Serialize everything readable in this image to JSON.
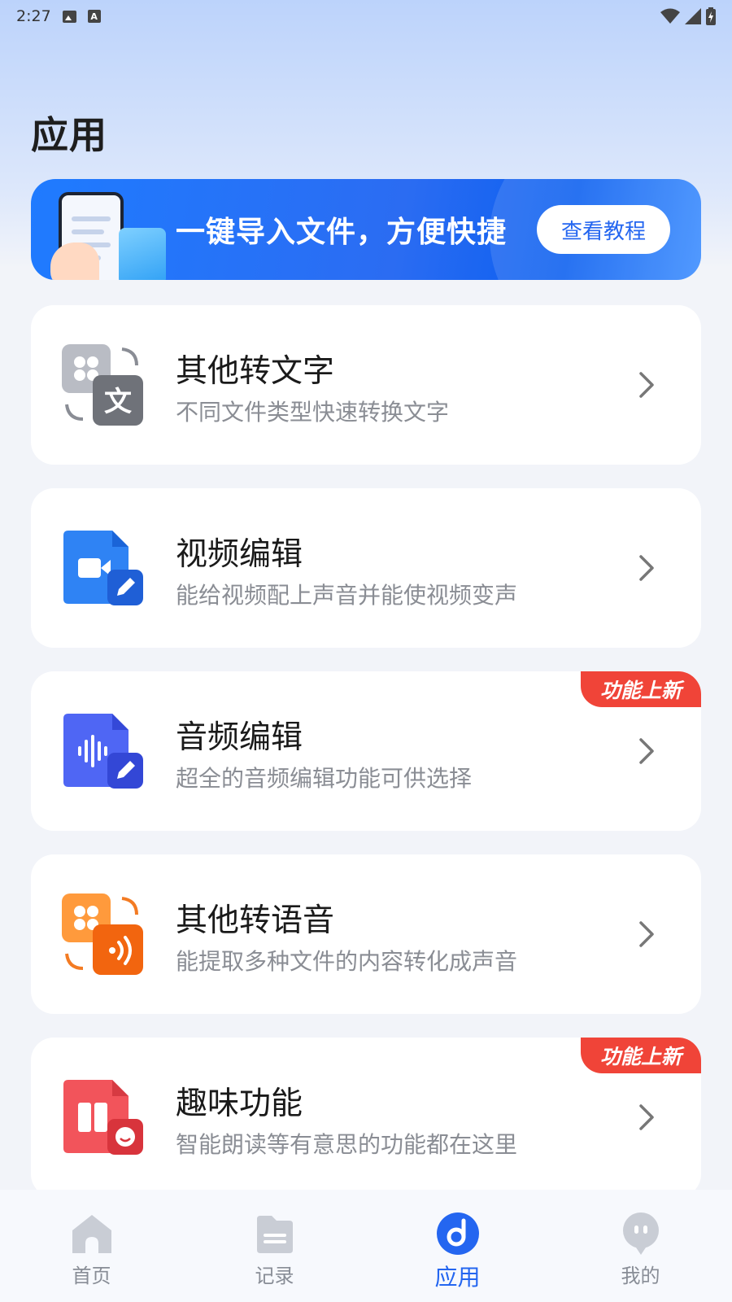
{
  "status_bar": {
    "time": "2:27",
    "left_icons": [
      "image-icon",
      "a-icon"
    ],
    "right_icons": [
      "wifi-icon",
      "signal-icon",
      "battery-icon"
    ]
  },
  "page": {
    "title": "应用"
  },
  "banner": {
    "text": "一键导入文件，方便快捷",
    "button_label": "查看教程",
    "color": "#2B6CF2"
  },
  "cards": [
    {
      "title": "其他转文字",
      "desc": "不同文件类型快速转换文字",
      "icon": "file-to-text-icon",
      "badge": "",
      "color": "#7d8088"
    },
    {
      "title": "视频编辑",
      "desc": "能给视频配上声音并能使视频变声",
      "icon": "video-edit-icon",
      "badge": "",
      "color": "#2b7bf0"
    },
    {
      "title": "音频编辑",
      "desc": "超全的音频编辑功能可供选择",
      "icon": "audio-edit-icon",
      "badge": "功能上新",
      "color": "#4a63f2"
    },
    {
      "title": "其他转语音",
      "desc": "能提取多种文件的内容转化成声音",
      "icon": "file-to-speech-icon",
      "badge": "",
      "color": "#f36a18"
    },
    {
      "title": "趣味功能",
      "desc": "智能朗读等有意思的功能都在这里",
      "icon": "fun-features-icon",
      "badge": "功能上新",
      "color": "#ee3f46"
    }
  ],
  "tabbar": {
    "active_color": "#2466F0",
    "inactive_color": "#888D96",
    "items": [
      {
        "label": "首页",
        "icon": "home-icon"
      },
      {
        "label": "记录",
        "icon": "records-icon"
      },
      {
        "label": "应用",
        "icon": "apps-icon",
        "active": true
      },
      {
        "label": "我的",
        "icon": "profile-icon"
      }
    ]
  }
}
